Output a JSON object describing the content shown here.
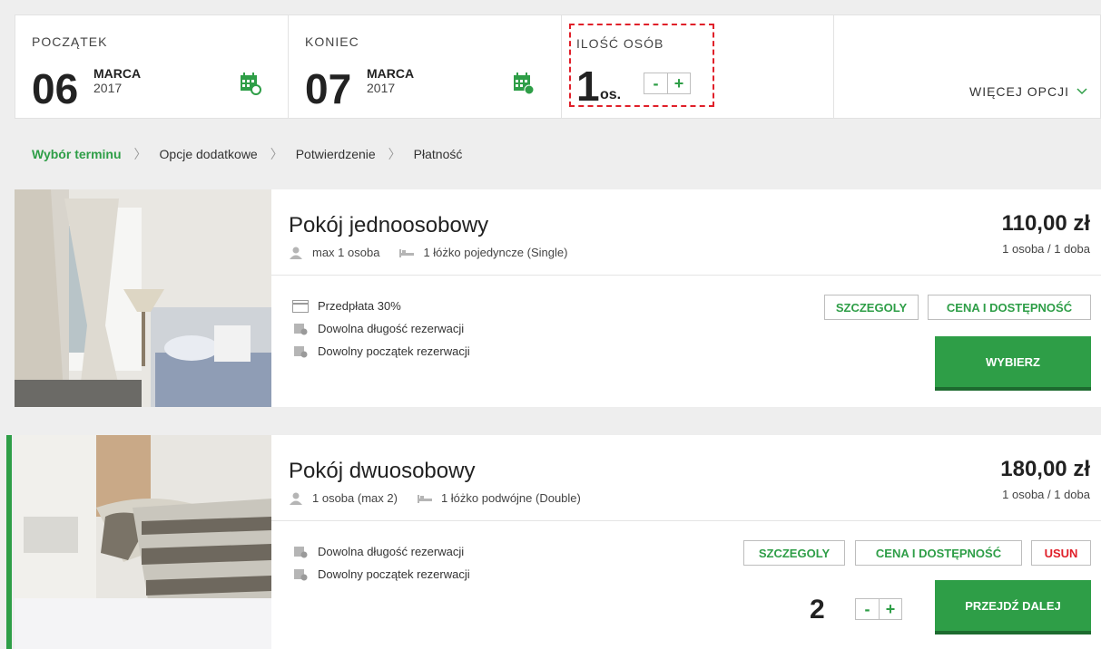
{
  "topbar": {
    "start": {
      "label": "POCZĄTEK",
      "day": "06",
      "month": "MARCA",
      "year": "2017"
    },
    "end": {
      "label": "KONIEC",
      "day": "07",
      "month": "MARCA",
      "year": "2017"
    },
    "people": {
      "label": "ILOŚĆ OSÓB",
      "count": "1",
      "unit": "os.",
      "minus": "-",
      "plus": "+"
    },
    "more_options": "WIĘCEJ OPCJI"
  },
  "breadcrumb": {
    "steps": [
      "Wybór terminu",
      "Opcje dodatkowe",
      "Potwierdzenie",
      "Płatność"
    ],
    "active_index": 0
  },
  "rooms": [
    {
      "title": "Pokój jednoosobowy",
      "capacity": "max 1 osoba",
      "beds": "1 łóżko pojedyncze (Single)",
      "price": "110,00 zł",
      "price_unit": "1 osoba / 1 doba",
      "features": [
        "Przedpłata 30%",
        "Dowolna długość rezerwacji",
        "Dowolny początek rezerwacji"
      ],
      "details_label": "SZCZEGOLY",
      "price_avail_label": "CENA I DOSTĘPNOŚĆ",
      "select_label": "WYBIERZ"
    },
    {
      "title": "Pokój dwuosobowy",
      "capacity": "1 osoba (max 2)",
      "beds": "1 łóżko podwójne (Double)",
      "price": "180,00 zł",
      "price_unit": "1 osoba / 1 doba",
      "features": [
        "Dowolna długość rezerwacji",
        "Dowolny początek rezerwacji"
      ],
      "details_label": "SZCZEGOLY",
      "price_avail_label": "CENA I DOSTĘPNOŚĆ",
      "remove_label": "USUN",
      "quantity": "2",
      "minus": "-",
      "plus": "+",
      "proceed_label": "PRZEJDŹ DALEJ"
    }
  ],
  "colors": {
    "accent": "#2e9e47",
    "danger": "#e0202a",
    "text": "#222222",
    "background": "#eeeeee"
  }
}
